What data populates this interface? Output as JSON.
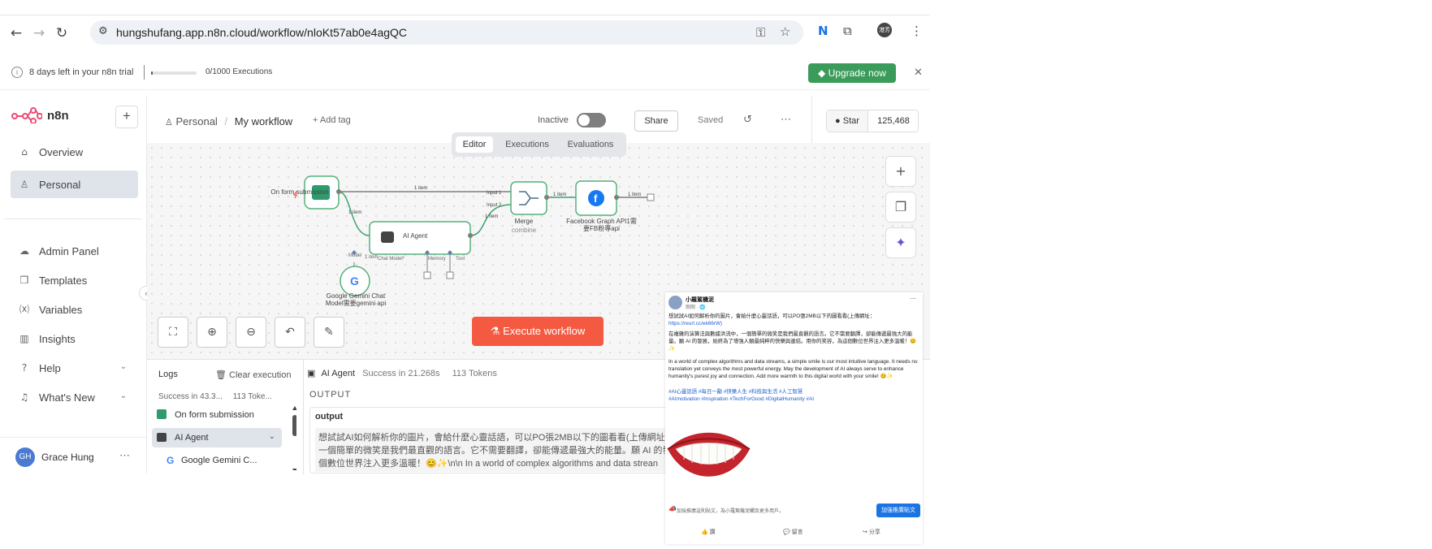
{
  "browser": {
    "url": "hungshufang.app.n8n.cloud/workflow/nloKt57ab0e4agQC",
    "profile_initials": "港芳"
  },
  "trial": {
    "days_left": "8 days left in your n8n trial",
    "executions": "0/1000 Executions",
    "executions_used_fraction": 0.0,
    "upgrade_label": "Upgrade now"
  },
  "sidebar": {
    "brand": "n8n",
    "items": [
      {
        "label": "Overview",
        "icon": "home-icon"
      },
      {
        "label": "Personal",
        "icon": "user-icon"
      },
      {
        "label": "Admin Panel",
        "icon": "cloud-icon"
      },
      {
        "label": "Templates",
        "icon": "templates-icon"
      },
      {
        "label": "Variables",
        "icon": "variables-icon"
      },
      {
        "label": "Insights",
        "icon": "insights-icon"
      },
      {
        "label": "Help",
        "icon": "help-icon"
      },
      {
        "label": "What's New",
        "icon": "bell-icon"
      }
    ],
    "user": {
      "initials": "GH",
      "name": "Grace Hung"
    }
  },
  "header": {
    "project": "Personal",
    "workflow_name": "My workflow",
    "add_tag": "+ Add tag",
    "status": "Inactive",
    "share": "Share",
    "saved": "Saved",
    "github_star": "Star",
    "github_count": "125,468"
  },
  "tabs": [
    "Editor",
    "Executions",
    "Evaluations"
  ],
  "workflow": {
    "nodes": {
      "form": "On form submission",
      "agent": "AI Agent",
      "merge": "Merge",
      "merge_sub": "combine",
      "facebook_line1": "Facebook Graph API1需",
      "facebook_line2": "要FB粉專api",
      "gemini_line1": "Google Gemini Chat",
      "gemini_line2": "Model需要gemini api"
    },
    "edge_labels": {
      "item": "1 item",
      "input1": "Input 1",
      "input2": "Input 2",
      "model": "Model",
      "chat_model": "Chat Model*",
      "memory": "Memory",
      "tool": "Tool"
    },
    "execute_label": "Execute workflow"
  },
  "logs": {
    "title": "Logs",
    "clear": "Clear execution",
    "summary": "Success in 43.3...",
    "tokens_short": "113 Toke...",
    "rows": [
      "On form submission",
      "AI Agent",
      "Google Gemini C..."
    ],
    "detail_node": "AI Agent",
    "detail_status": "Success in 21.268s",
    "detail_tokens": "113 Tokens",
    "output_label": "OUTPUT",
    "output_key": "output",
    "output_line1": "想試試AI如何解析你的圖片，會給什麼心靈話語，可以PO張2MB以下的圖看看(上傳網址：h",
    "output_line2": "一個簡單的微笑是我們最直觀的語言。它不需要翻譯，卻能傳遞最強大的能量。願 AI 的發展",
    "output_line3": "個數位世界注入更多溫暖！😊✨\\n\\n In a world of complex algorithms and data strean"
  },
  "facebook_post": {
    "author": "小羅駕機泥",
    "meta": "剛剛 · 🌐",
    "text1": "想試試AI如何解析你的圖片，會給什麼心靈話語，可以PO張2MB以下的圖看看(上傳網址：",
    "link": "https://reurl.cc/ek66rW)",
    "text2": "在複雜的演算法與數據洪流中，一個簡單的微笑是我們最直觀的語言。它不需要翻譯，卻能傳遞最強大的能量。願 AI 的發展，始終為了增強人類最純粹的快樂與連結。用你的笑容，為這個數位世界注入更多溫暖！😊✨",
    "text3": "In a world of complex algorithms and data streams, a simple smile is our most intuitive language. It needs no translation yet conveys the most powerful energy. May the development of AI always serve to enhance humanity's purest joy and connection. Add more warmth to this digital world with your smile! 😊✨",
    "tags1": "#AI心靈話語 #每日一勵 #快樂人生 #科技與生活 #人工智慧",
    "tags2": "#AImotivation #Inspiration #TechForGood #DigitalHumanity #AI",
    "boost_hint": "加強推廣這則貼文，為小羅駕機泥觸及更多用戶。",
    "boost_button": "加強推廣貼文",
    "actions": [
      "讚",
      "留言",
      "分享"
    ]
  },
  "colors": {
    "node_border": "#55b07a",
    "execute": "#f45a41",
    "upgrade": "#3b9b5a",
    "facebook": "#1877f2"
  }
}
